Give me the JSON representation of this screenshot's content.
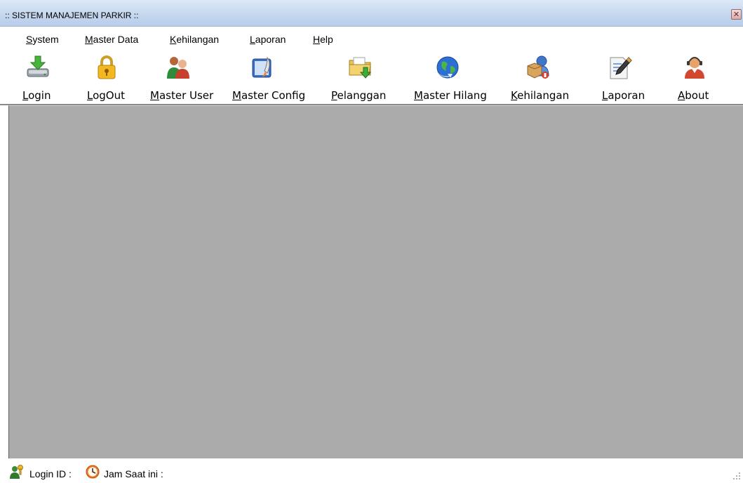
{
  "window": {
    "title": ":: SISTEM MANAJEMEN PARKIR ::",
    "close_icon": "close-icon"
  },
  "menu": {
    "items": [
      {
        "label": "System"
      },
      {
        "label": "Master Data"
      },
      {
        "label": "Kehilangan"
      },
      {
        "label": "Laporan"
      },
      {
        "label": "Help"
      }
    ]
  },
  "toolbar": {
    "items": [
      {
        "label": "Login",
        "icon": "login-drive-arrow-icon"
      },
      {
        "label": "LogOut",
        "icon": "padlock-icon"
      },
      {
        "label": "Master User",
        "icon": "users-icon"
      },
      {
        "label": "Master Config",
        "icon": "config-rocket-icon"
      },
      {
        "label": "Pelanggan",
        "icon": "folder-arrow-icon"
      },
      {
        "label": "Master Hilang",
        "icon": "globe-arrow-icon"
      },
      {
        "label": "Kehilangan",
        "icon": "user-box-icon"
      },
      {
        "label": "Laporan",
        "icon": "document-pen-icon"
      },
      {
        "label": "About",
        "icon": "support-person-icon"
      }
    ]
  },
  "workspace": {
    "background": "#ababab"
  },
  "status": {
    "login_label": "Login ID :",
    "time_label": "Jam Saat ini :"
  }
}
